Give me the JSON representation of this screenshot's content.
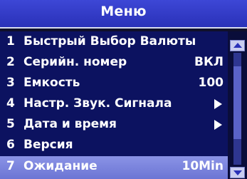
{
  "header": {
    "title": "Меню"
  },
  "menu": {
    "items": [
      {
        "number": "1",
        "label": "Быстрый Выбор Валюты",
        "value": ""
      },
      {
        "number": "2",
        "label": "Серийн. номер",
        "value": "ВКЛ"
      },
      {
        "number": "3",
        "label": "Емкость",
        "value": "100"
      },
      {
        "number": "4",
        "label": "Настр. Звук. Сигнала",
        "value": ""
      },
      {
        "number": "5",
        "label": "Дата и время",
        "value": ""
      },
      {
        "number": "6",
        "label": "Версия",
        "value": ""
      },
      {
        "number": "7",
        "label": "Ожидание",
        "value": "10Min"
      }
    ],
    "selected_index": 6
  },
  "scrollbar": {
    "position_fraction": 0.35
  },
  "icons": {
    "submenu_arrow": "chevron-right-icon",
    "scroll_up": "scroll-up-icon",
    "scroll_down": "scroll-down-icon"
  },
  "colors": {
    "header_bg": "#2a31b8",
    "list_bg": "#0c1260",
    "selected_bg": "#6c75d4",
    "text": "#ffffff"
  }
}
